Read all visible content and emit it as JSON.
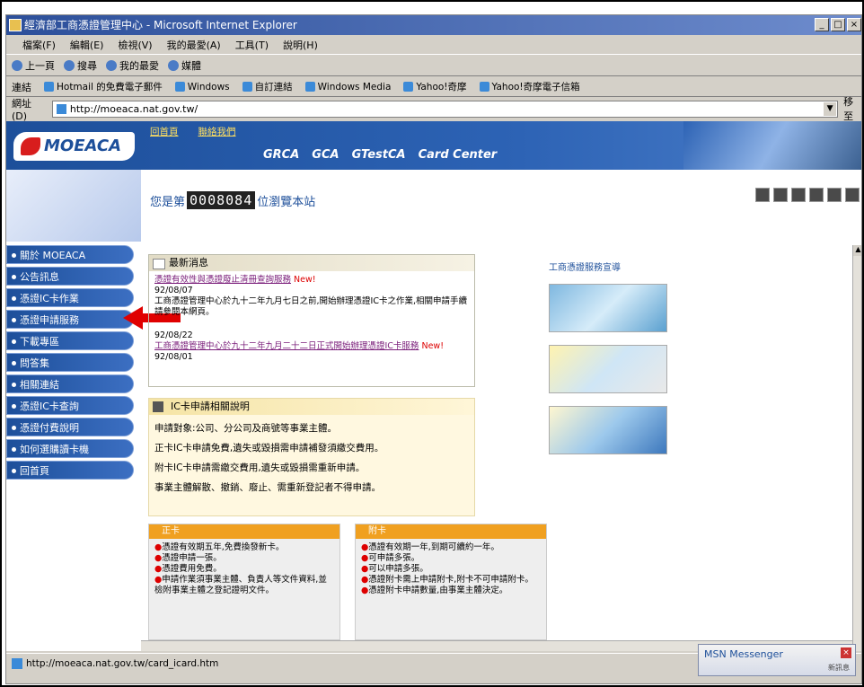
{
  "window": {
    "title": "經濟部工商憑證管理中心 - Microsoft Internet Explorer",
    "controls": [
      "_",
      "□",
      "×"
    ]
  },
  "menu": [
    "檔案(F)",
    "編輯(E)",
    "檢視(V)",
    "我的最愛(A)",
    "工具(T)",
    "說明(H)"
  ],
  "toolbar": {
    "back": "上一頁",
    "search": "搜尋",
    "favorites": "我的最愛",
    "media": "媒體"
  },
  "links": {
    "label": "連結",
    "items": [
      "Hotmail 的免費電子郵件",
      "Windows",
      "自訂連結",
      "Windows Media",
      "Yahoo!奇摩",
      "Yahoo!奇摩電子信箱"
    ]
  },
  "address": {
    "label": "網址(D)",
    "url": "http://moeaca.nat.gov.tw/",
    "go": "移至"
  },
  "site": {
    "logo": "MOEACA",
    "toplinks": [
      "回首頁",
      "聯絡我們"
    ],
    "nav": [
      "GRCA",
      "GCA",
      "GTestCA",
      "Card Center"
    ],
    "counter_prefix": "您是第",
    "counter_value": "0008084",
    "counter_suffix": "位瀏覽本站"
  },
  "leftnav": [
    "關於 MOEACA",
    "公告訊息",
    "憑證IC卡作業",
    "憑證申請服務",
    "下載專區",
    "問答集",
    "相關連結",
    "憑證IC卡查詢",
    "憑證付費說明",
    "如何選購讀卡機",
    "回首頁"
  ],
  "news": {
    "header": "最新消息",
    "items": [
      {
        "link": "憑證有效性與憑證廢止清冊查詢服務",
        "badge": "New!",
        "date": "92/08/07",
        "text": "工商憑證管理中心於九十二年九月七日之前,開始辦理憑證IC卡之作業,相關申請手續請參閱本網頁。"
      },
      {
        "date": "92/08/22",
        "link": "工商憑證管理中心於九十二年九月二十二日正式開始辦理憑證IC卡服務",
        "badge": "New!",
        "date2": "92/08/01"
      }
    ]
  },
  "icinfo": {
    "header": "IC卡申請相關說明",
    "items": [
      "申請對象:公司、分公司及商號等事業主體。",
      "正卡IC卡申請免費,遺失或毀損需申請補發須繳交費用。",
      "附卡IC卡申請需繳交費用,遺失或毀損需重新申請。",
      "事業主體解散、撤銷、廢止、需重新登記者不得申請。"
    ]
  },
  "rightcol": {
    "header": "工商憑證服務宣導"
  },
  "boxes": [
    {
      "header": "正卡",
      "lines": [
        "憑證有效期五年,免費換發新卡。",
        "憑證申請一張。",
        "憑證費用免費。",
        "申請作業須事業主體、負責人等文件資料,並檢附事業主體之登記證明文件。"
      ]
    },
    {
      "header": "附卡",
      "lines": [
        "憑證有效期一年,到期可續約一年。",
        "可申請多張。",
        "可以申請多張。",
        "憑證附卡需上申請附卡,附卡不可申請附卡。",
        "憑證附卡申請數量,由事業主體決定。"
      ]
    }
  ],
  "status": {
    "url": "http://moeaca.nat.gov.tw/card_icard.htm",
    "msn": "MSN Messenger",
    "msn_sub": "新訊息"
  }
}
